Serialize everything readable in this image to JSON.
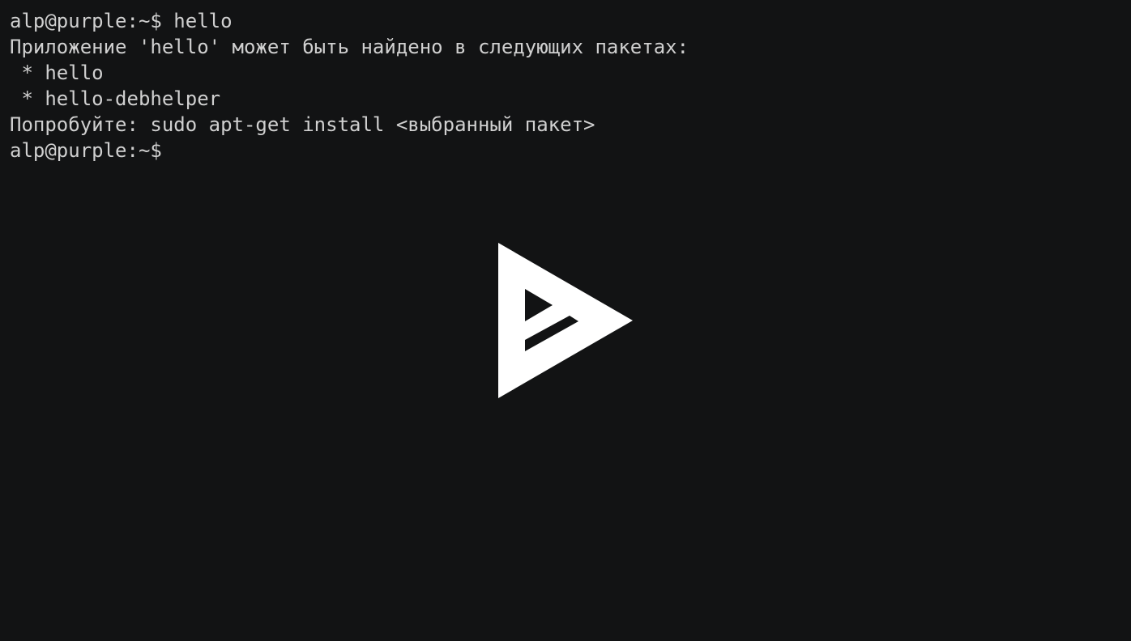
{
  "terminal": {
    "lines": [
      "alp@purple:~$ hello",
      "Приложение 'hello' может быть найдено в следующих пакетах:",
      " * hello",
      " * hello-debhelper",
      "Попробуйте: sudo apt-get install <выбранный пакет>",
      "alp@purple:~$ "
    ],
    "text_color": "#d0d0d0",
    "background_color": "#121314"
  },
  "player": {
    "play_icon": "asciinema-play-icon",
    "icon_color": "#ffffff"
  }
}
